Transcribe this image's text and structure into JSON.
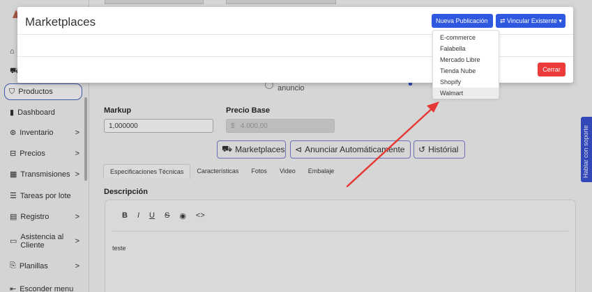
{
  "sidebar": {
    "items": [
      {
        "label": "Productos",
        "icon": "tag-icon",
        "active": true
      },
      {
        "label": "Dashboard",
        "icon": "bar-chart-icon"
      },
      {
        "label": "Inventario",
        "icon": "box-icon",
        "chevron": ">"
      },
      {
        "label": "Precios",
        "icon": "price-tag-icon",
        "chevron": ">"
      },
      {
        "label": "Transmisiones",
        "icon": "calendar-icon",
        "chevron": ">"
      },
      {
        "label": "Tareas por lote",
        "icon": "list-icon"
      },
      {
        "label": "Registro",
        "icon": "clipboard-icon",
        "chevron": ">"
      },
      {
        "label": "Asistencia al Cliente",
        "icon": "chat-icon",
        "chevron": ">"
      },
      {
        "label": "Planillas",
        "icon": "sheet-icon",
        "chevron": ">"
      },
      {
        "label": "Esconder menu",
        "icon": "collapse-icon"
      }
    ]
  },
  "form": {
    "anuncio_text": "anuncio",
    "markup_label": "Markup",
    "markup_value": "1,000000",
    "precio_base_label": "Precio Base",
    "precio_base_currency": "$",
    "precio_base_value": "4.000,00",
    "buttons": {
      "marketplaces": "Marketplaces",
      "anunciar": "Anunciar Automáticamente",
      "historial": "Histórial"
    },
    "tabs": [
      "Especificaciones Técnicas",
      "Características",
      "Fotos",
      "Video",
      "Embalaje"
    ],
    "description_label": "Descripción",
    "editor_tools": [
      "B",
      "I",
      "U",
      "S",
      "◉",
      "<>"
    ],
    "editor_content": "teste"
  },
  "support_tab": "Hablar con soporte",
  "modal": {
    "title": "Marketplaces",
    "new_button": "Nueva Publicación",
    "link_button": "⇄ Vincular Existente ▾",
    "close_button": "Cerrar",
    "dropdown_items": [
      "E-commerce",
      "Falabella",
      "Mercado Libre",
      "Tienda Nube",
      "Shopify",
      "Walmart"
    ],
    "hovered_item": "Walmart"
  },
  "colors": {
    "primary": "#2f58e0",
    "danger": "#ec3b3b",
    "arrow": "#e53935",
    "support": "#3248b8"
  }
}
